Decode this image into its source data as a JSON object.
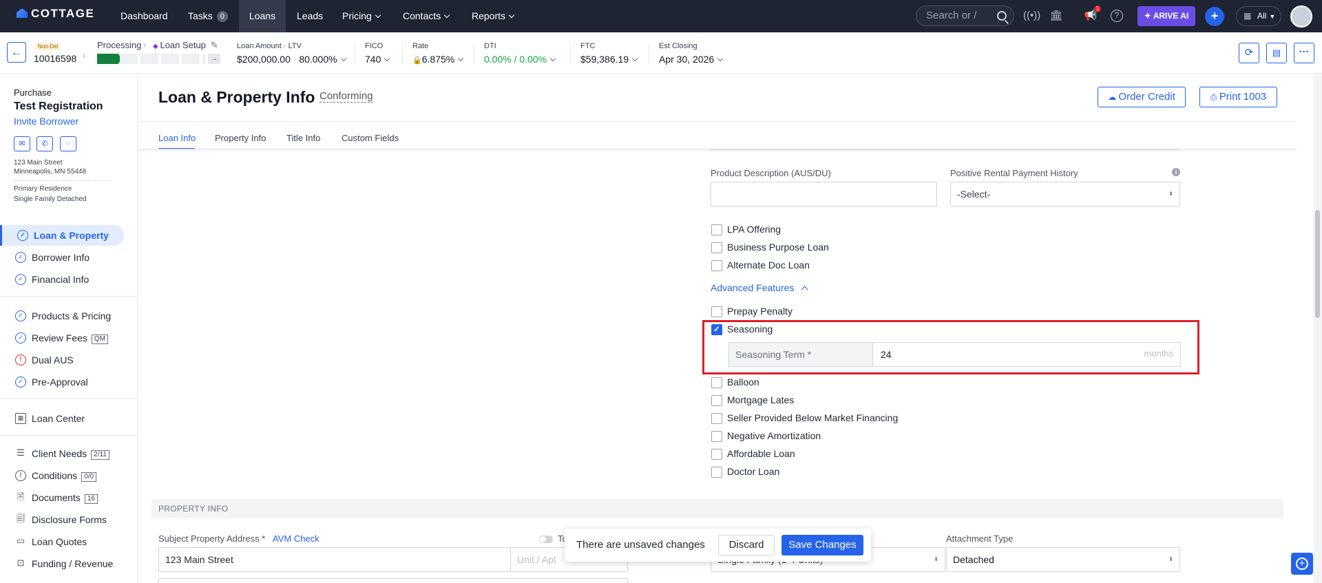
{
  "nav": {
    "logo": "COTTAGE",
    "items": [
      {
        "label": "Dashboard"
      },
      {
        "label": "Tasks",
        "badge": "0"
      },
      {
        "label": "Loans"
      },
      {
        "label": "Leads"
      },
      {
        "label": "Pricing"
      },
      {
        "label": "Contacts"
      },
      {
        "label": "Reports"
      }
    ],
    "search_placeholder": "Search or /",
    "notification_count": "1",
    "ai_button": "ARIVE AI",
    "scope": "All"
  },
  "loan_bar": {
    "loan_type": "Non-Del",
    "loan_number": "10016598",
    "stage": "Processing",
    "substage": "Loan Setup",
    "loan_amount_label": "Loan Amount · LTV",
    "loan_amount": "$200,000.00",
    "ltv": "80.000%",
    "fico_label": "FICO",
    "fico": "740",
    "rate_label": "Rate",
    "rate": "6.875%",
    "dti_label": "DTI",
    "dti_front": "0.00%",
    "dti_sep": "/",
    "dti_back": "0.00%",
    "ftc_label": "FTC",
    "ftc": "$59,386.19",
    "closing_label": "Est Closing",
    "closing": "Apr 30, 2026"
  },
  "sidebar": {
    "purpose": "Purchase",
    "borrower": "Test Registration",
    "invite": "Invite Borrower",
    "address1": "123 Main Street",
    "address2": "Minneapolis, MN 55448",
    "occupancy": "Primary Residence",
    "property_type": "Single Family Detached",
    "items": [
      {
        "label": "Loan & Property"
      },
      {
        "label": "Borrower Info"
      },
      {
        "label": "Financial Info"
      },
      {
        "label": "Products & Pricing"
      },
      {
        "label": "Review Fees",
        "tag": "QM"
      },
      {
        "label": "Dual AUS"
      },
      {
        "label": "Pre-Approval"
      },
      {
        "label": "Loan Center"
      },
      {
        "label": "Client Needs",
        "tag": "2/11"
      },
      {
        "label": "Conditions",
        "tag": "0/0"
      },
      {
        "label": "Documents",
        "tag": "16"
      },
      {
        "label": "Disclosure Forms"
      },
      {
        "label": "Loan Quotes"
      },
      {
        "label": "Funding / Revenue"
      }
    ]
  },
  "page": {
    "title": "Loan & Property Info",
    "program": "Conforming",
    "order_credit": "Order Credit",
    "print": "Print 1003",
    "tabs": [
      "Loan Info",
      "Property Info",
      "Title Info",
      "Custom Fields"
    ]
  },
  "form": {
    "product_desc_label": "Product Description (AUS/DU)",
    "rental_history_label": "Positive Rental Payment History",
    "rental_history_value": "-Select-",
    "checks1": [
      "LPA Offering",
      "Business Purpose Loan",
      "Alternate Doc Loan"
    ],
    "advanced_toggle": "Advanced Features",
    "prepay": "Prepay Penalty",
    "seasoning": "Seasoning",
    "seasoning_term_label": "Seasoning Term *",
    "seasoning_term_value": "24",
    "seasoning_unit": "months",
    "checks2": [
      "Balloon",
      "Mortgage Lates",
      "Seller Provided Below Market Financing",
      "Negative Amortization",
      "Affordable Loan",
      "Doctor Loan"
    ]
  },
  "property": {
    "section": "PROPERTY INFO",
    "address_label": "Subject Property Address *",
    "avm": "AVM Check",
    "address_value": "123 Main Street",
    "unit_placeholder": "Unit / Apt",
    "toggle_label": "To",
    "property_type_value": "Single Family (1-4 Units)",
    "attachment_label": "Attachment Type",
    "attachment_value": "Detached"
  },
  "toast": {
    "message": "There are unsaved changes",
    "discard": "Discard",
    "save": "Save Changes"
  },
  "colors": {
    "accent": "#2563eb",
    "nav_bg": "#1f2433",
    "highlight": "#e11d2a",
    "ai": "#6b4de6"
  }
}
